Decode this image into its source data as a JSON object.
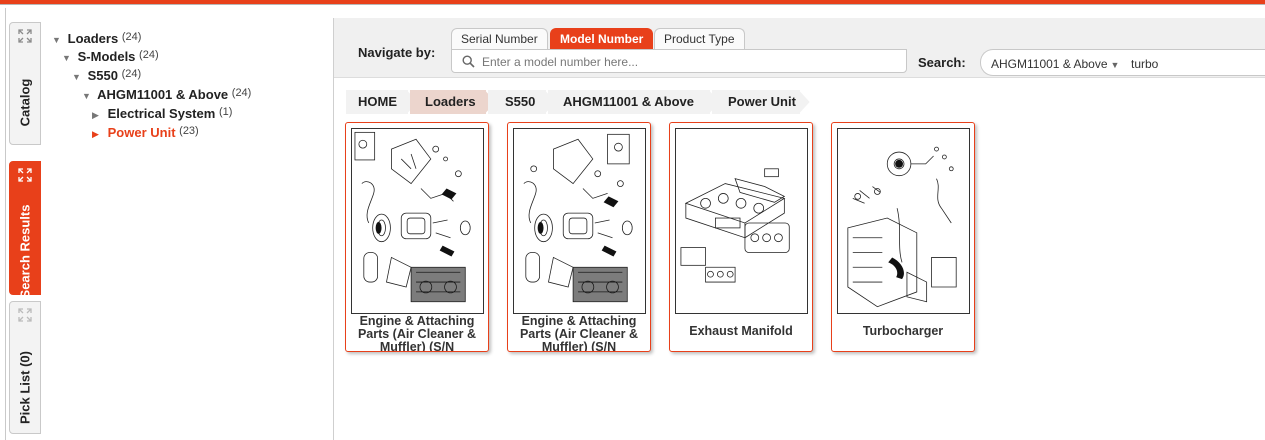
{
  "sidebar_tabs": [
    {
      "label": "Catalog",
      "icon": "expand-icon",
      "active": false
    },
    {
      "label": "Search Results",
      "icon": "expand-icon",
      "active": true
    },
    {
      "label": "Pick List (0)",
      "icon": "expand-icon",
      "active": false
    }
  ],
  "tree": [
    {
      "label": "Loaders",
      "count": "(24)",
      "expanded": true,
      "selected": false
    },
    {
      "label": "S-Models",
      "count": "(24)",
      "expanded": true,
      "selected": false
    },
    {
      "label": "S550",
      "count": "(24)",
      "expanded": true,
      "selected": false
    },
    {
      "label": "AHGM11001 & Above",
      "count": "(24)",
      "expanded": true,
      "selected": false
    },
    {
      "label": "Electrical System",
      "count": "(1)",
      "expanded": false,
      "selected": false
    },
    {
      "label": "Power Unit",
      "count": "(23)",
      "expanded": false,
      "selected": true
    }
  ],
  "navigate": {
    "label": "Navigate by:",
    "tabs": [
      "Serial Number",
      "Model Number",
      "Product Type"
    ],
    "active_tab": "Model Number",
    "input_placeholder": "Enter a model number here..."
  },
  "search": {
    "label": "Search:",
    "scope": "AHGM11001 & Above",
    "query": "turbo"
  },
  "breadcrumb": [
    "HOME",
    "Loaders",
    "S550",
    "AHGM11001 & Above",
    "Power Unit"
  ],
  "results": [
    {
      "title": "Engine & Attaching Parts (Air Cleaner & Muffler) (S/N"
    },
    {
      "title": "Engine & Attaching Parts (Air Cleaner & Muffler) (S/N"
    },
    {
      "title": "Exhaust Manifold"
    },
    {
      "title": "Turbocharger"
    }
  ],
  "colors": {
    "accent": "#e8401a",
    "crumb_active": "#ecd5cd",
    "topbar_bg": "#f0f0f0"
  }
}
